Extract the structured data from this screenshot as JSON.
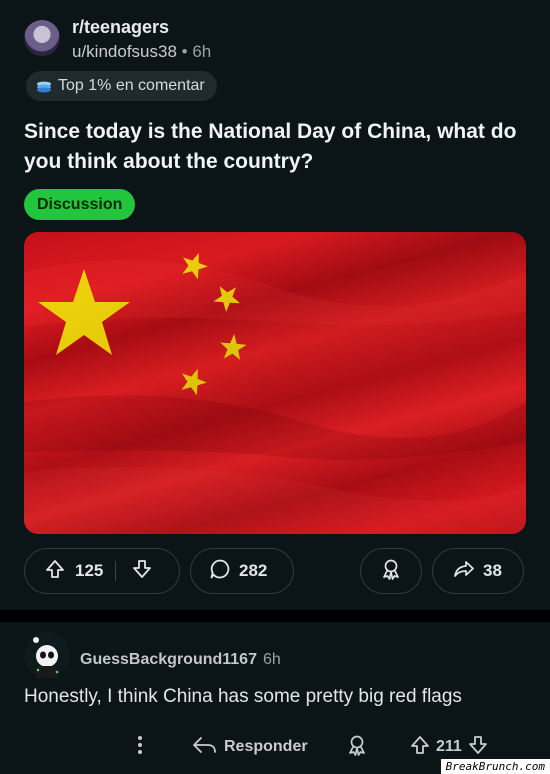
{
  "post": {
    "subreddit": "r/teenagers",
    "username": "u/kindofsus38",
    "separator": "•",
    "age": "6h",
    "badge_label": "Top 1% en comentar",
    "title": "Since today is the National Day of China, what do you think about the country?",
    "flair": "Discussion",
    "upvotes": "125",
    "comments": "282",
    "shares": "38"
  },
  "comment": {
    "username": "GuessBackground1167",
    "age": "6h",
    "text": "Honestly, I think China has some pretty big red flags",
    "reply_label": "Responder",
    "upvotes": "211"
  },
  "watermark": "BreakBrunch.com",
  "colors": {
    "background": "#0b1416",
    "flair_bg": "#22c53b",
    "flag_red": "#e61b22",
    "flag_star": "#f5d90a"
  },
  "icons": [
    "community-avatar",
    "achievement-badge-icon",
    "upvote-icon",
    "downvote-icon",
    "comment-icon",
    "award-icon",
    "share-icon",
    "more-options-icon",
    "reply-icon"
  ]
}
